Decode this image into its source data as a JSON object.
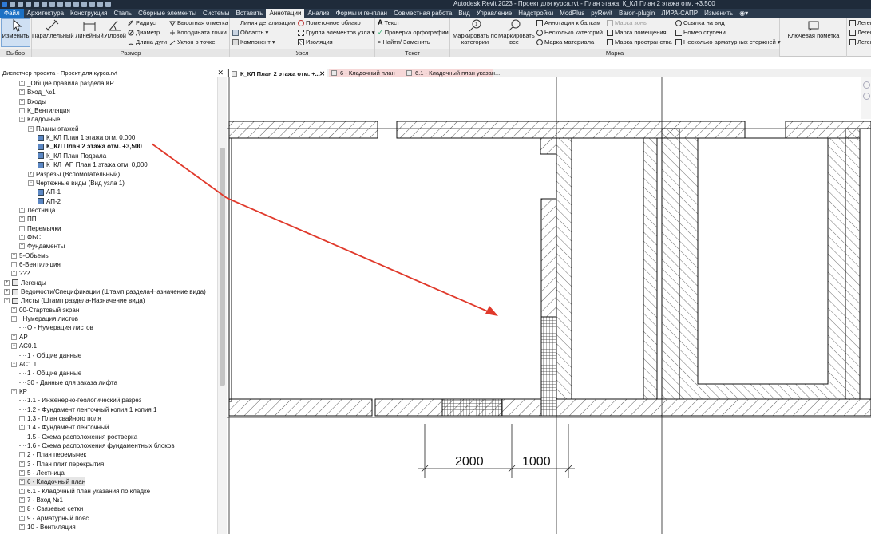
{
  "window": {
    "title": "Autodesk Revit 2023 - Проект для курса.rvt - План этажа: К_КЛ План 2 этажа отм. +3,500"
  },
  "menu": {
    "file": "Файл",
    "tabs": [
      "Архитектура",
      "Конструкция",
      "Сталь",
      "Сборные элементы",
      "Системы",
      "Вставить",
      "Аннотации",
      "Анализ",
      "Формы и генплан",
      "Совместная работа",
      "Вид",
      "Управление",
      "Надстройки",
      "ModPlus",
      "pyRevit",
      "Baron-plugin",
      "ЛИРА-САПР",
      "Изменить"
    ],
    "active_index": 6
  },
  "ribbon": {
    "select": {
      "modify": "Изменить",
      "panel": "Выбор"
    },
    "dimension": {
      "aligned": "Параллельный",
      "linear": "Линейный",
      "angular": "Угловой",
      "radius": "Радиус",
      "diameter": "Диаметр",
      "arc_length": "Длина дуги",
      "spot_elevation": "Высотная отметка",
      "spot_coordinate": "Координата точки",
      "spot_slope": "Уклон в точке",
      "panel": "Размер"
    },
    "detail": {
      "detail_line": "Линия детализации",
      "region": "Область",
      "component": "Компонент",
      "revision_cloud": "Пометочное облако",
      "detail_group": "Группа элементов узла",
      "insulation": "Изоляция",
      "panel": "Узел"
    },
    "text": {
      "text": "Текст",
      "spelling": "Проверка орфографии",
      "find_replace": "Найти/ Заменить",
      "panel": "Текст"
    },
    "tag": {
      "tag_by_category": "Маркировать по категории",
      "tag_all": "Маркировать все",
      "beam_annotations": "Аннотации к балкам",
      "multi_category": "Несколько категорий",
      "material_tag": "Марка материала",
      "area_tag": "Марка зоны",
      "room_tag": "Марка помещения",
      "space_tag": "Марка пространства",
      "view_reference": "Ссылка на вид",
      "tread_number": "Номер ступени",
      "multi_rebar": "Несколько арматурных стержней",
      "keynote": "Ключевая пометка",
      "panel": "Марка"
    },
    "legend": {
      "items": [
        "Леген",
        "Леген",
        "Леген"
      ]
    }
  },
  "project_browser": {
    "title": "Диспетчер проекта - Проект для курса.rvt",
    "nodes": [
      {
        "text": "_Общие правила раздела КР",
        "lvl": 2,
        "exp": "+"
      },
      {
        "text": "Вход_№1",
        "lvl": 2,
        "exp": "+"
      },
      {
        "text": "Входы",
        "lvl": 2,
        "exp": "+"
      },
      {
        "text": "К_Вентиляция",
        "lvl": 2,
        "exp": "+"
      },
      {
        "text": "Кладочные",
        "lvl": 2,
        "exp": "-"
      },
      {
        "text": "Планы этажей",
        "lvl": 3,
        "exp": "-"
      },
      {
        "text": "К_КЛ План 1 этажа отм. 0,000",
        "lvl": 4,
        "icon": "view"
      },
      {
        "text": "К_КЛ План 2 этажа отм. +3,500",
        "lvl": 4,
        "icon": "view",
        "bold": true
      },
      {
        "text": "К_КЛ План Подвала",
        "lvl": 4,
        "icon": "view"
      },
      {
        "text": "К_КЛ_АП План 1 этажа отм. 0,000",
        "lvl": 4,
        "icon": "view"
      },
      {
        "text": "Разрезы (Вспомогательный)",
        "lvl": 3,
        "exp": "+"
      },
      {
        "text": "Чертежные виды (Вид узла 1)",
        "lvl": 3,
        "exp": "-"
      },
      {
        "text": "АП-1",
        "lvl": 4,
        "icon": "view"
      },
      {
        "text": "АП-2",
        "lvl": 4,
        "icon": "view"
      },
      {
        "text": "Лестница",
        "lvl": 2,
        "exp": "+"
      },
      {
        "text": "ПП",
        "lvl": 2,
        "exp": "+"
      },
      {
        "text": "Перемычки",
        "lvl": 2,
        "exp": "+"
      },
      {
        "text": "ФБС",
        "lvl": 2,
        "exp": "+"
      },
      {
        "text": "Фундаменты",
        "lvl": 2,
        "exp": "+"
      },
      {
        "text": "5-Объемы",
        "lvl": 1,
        "exp": "+"
      },
      {
        "text": "6-Вентиляция",
        "lvl": 1,
        "exp": "+"
      },
      {
        "text": "???",
        "lvl": 1,
        "exp": "+"
      },
      {
        "text": "Легенды",
        "lvl": 0,
        "exp": "+",
        "icon": "table"
      },
      {
        "text": "Ведомости/Спецификации (Штамп раздела-Назначение вида)",
        "lvl": 0,
        "exp": "+",
        "icon": "table"
      },
      {
        "text": "Листы (Штамп раздела-Назначение вида)",
        "lvl": 0,
        "exp": "-",
        "icon": "table"
      },
      {
        "text": "00-Стартовый экран",
        "lvl": 1,
        "exp": "+"
      },
      {
        "text": "_Нумерация листов",
        "lvl": 1,
        "exp": "-"
      },
      {
        "text": "О - Нумерация листов",
        "lvl": 2
      },
      {
        "text": "АР",
        "lvl": 1,
        "exp": "+"
      },
      {
        "text": "АС0.1",
        "lvl": 1,
        "exp": "-"
      },
      {
        "text": "1 - Общие данные",
        "lvl": 2
      },
      {
        "text": "АС1.1",
        "lvl": 1,
        "exp": "-"
      },
      {
        "text": "1 - Общие данные",
        "lvl": 2
      },
      {
        "text": "30 - Данные для заказа лифта",
        "lvl": 2
      },
      {
        "text": "КР",
        "lvl": 1,
        "exp": "-"
      },
      {
        "text": "1.1 - Инженерно-геологический разрез",
        "lvl": 2
      },
      {
        "text": "1.2 - Фундамент ленточный копия 1 копия 1",
        "lvl": 2
      },
      {
        "text": "1.3 - План свайного поля",
        "lvl": 2,
        "exp": "+"
      },
      {
        "text": "1.4 - Фундамент ленточный",
        "lvl": 2,
        "exp": "+"
      },
      {
        "text": "1.5 - Схема расположения ростверка",
        "lvl": 2
      },
      {
        "text": "1.6 - Схема расположения фундаментных блоков",
        "lvl": 2
      },
      {
        "text": "2 - План перемычек",
        "lvl": 2,
        "exp": "+"
      },
      {
        "text": "3 - План плит перекрытия",
        "lvl": 2,
        "exp": "+"
      },
      {
        "text": "5 - Лестница",
        "lvl": 2,
        "exp": "+"
      },
      {
        "text": "6 - Кладочный план",
        "lvl": 2,
        "exp": "+",
        "selected": true
      },
      {
        "text": "6.1 - Кладочный план указания по кладке",
        "lvl": 2,
        "exp": "+"
      },
      {
        "text": "7 - Вход №1",
        "lvl": 2,
        "exp": "+"
      },
      {
        "text": "8 - Связевые сетки",
        "lvl": 2,
        "exp": "+"
      },
      {
        "text": "9 - Арматурный пояс",
        "lvl": 2,
        "exp": "+"
      },
      {
        "text": "10 - Вентиляция",
        "lvl": 2,
        "exp": "+"
      }
    ]
  },
  "view_tabs": [
    {
      "label": "К_КЛ План 2 этажа отм. +...",
      "active": true
    },
    {
      "label": "6 - Кладочный план"
    },
    {
      "label": "6.1 - Кладочный план указан..."
    }
  ],
  "drawing": {
    "dimensions": [
      "2000",
      "1000"
    ]
  },
  "colors": {
    "arrow": "#e0392b",
    "accent": "#1b70c4"
  }
}
